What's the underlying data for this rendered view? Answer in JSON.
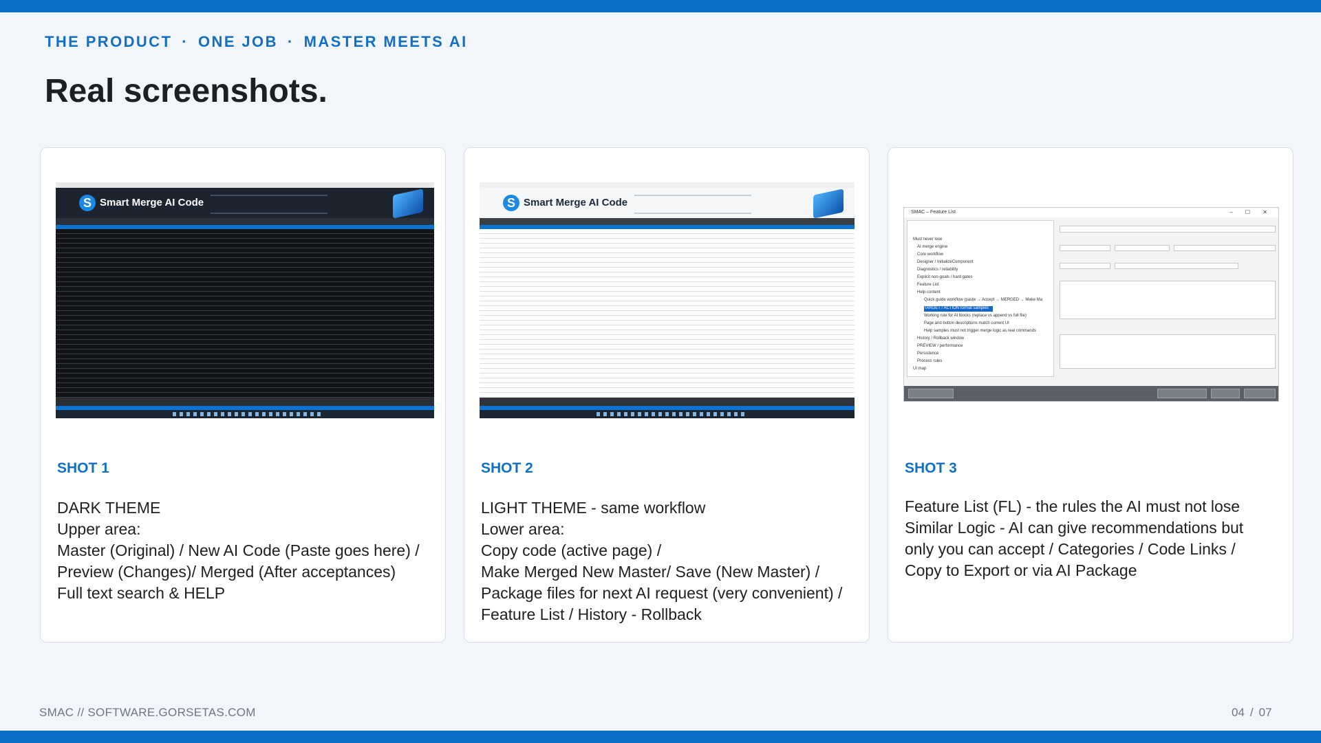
{
  "header": {
    "kicker": [
      "THE PRODUCT",
      "ONE JOB",
      "MASTER MEETS AI"
    ],
    "separator": "·",
    "title": "Real screenshots."
  },
  "cards": [
    {
      "label": "SHOT 1",
      "lines": [
        "DARK THEME",
        "Upper area:",
        "Master (Original) / New AI Code (Paste goes here) /",
        "Preview (Changes)/ Merged (After acceptances)",
        "Full text search & HELP"
      ],
      "screenshot": {
        "theme": "dark",
        "app_name": "Smart Merge AI Code",
        "logo_letter": "S"
      }
    },
    {
      "label": "SHOT 2",
      "lines": [
        "LIGHT THEME - same workflow",
        "Lower area:",
        "Copy code (active page) /",
        "Make Merged New Master/ Save (New Master) /",
        "Package files for next AI request (very convenient) /",
        "Feature List / History - Rollback"
      ],
      "screenshot": {
        "theme": "light",
        "app_name": "Smart Merge AI Code",
        "logo_letter": "S"
      }
    },
    {
      "label": "SHOT 3",
      "lines": [
        "Feature List (FL) - the rules the AI must not lose",
        "Similar Logic - AI can give recommendations but",
        "only you can accept / Categories / Code Links /",
        "Copy to Export or via AI Package"
      ],
      "screenshot": {
        "window_title": "SMAC – Feature List",
        "window_buttons": "– ☐ ✕",
        "tree_items": [
          "Must never lose",
          "AI merge engine",
          "Core workflow",
          "Designer / InitializeComponent",
          "Diagnostics / reliability",
          "Explicit non-goals / hard gates",
          "Feature List",
          "Help content",
          "Quick guide workflow (paste → Accept → MERGED → Make Ma",
          "TARGET / ACTION format samples",
          "Working rule for AI blocks (replace vs append vs full file)",
          "Page and button descriptions match current UI",
          "Help samples must not trigger merge logic as real commands",
          "History / Rollback window",
          "PREVIEW / performance",
          "Persistence",
          "Process rules",
          "UI map"
        ]
      }
    }
  ],
  "footer": {
    "left": "SMAC // SOFTWARE.GORSETAS.COM",
    "page_current": "04",
    "page_sep": "/",
    "page_total": "07"
  },
  "colors": {
    "accent": "#1170c4",
    "bar": "#0a6fc9",
    "background": "#f2f6fb"
  }
}
